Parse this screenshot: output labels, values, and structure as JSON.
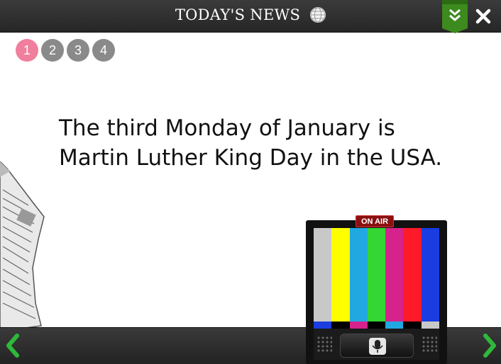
{
  "header": {
    "title": "TODAY'S NEWS",
    "globe_icon": "globe-icon",
    "bookmark_icon": "double-chevron-down-icon",
    "close_icon": "close-icon",
    "bookmark_color": "#3d8a1f"
  },
  "pager": {
    "pages": [
      "1",
      "2",
      "3",
      "4"
    ],
    "active_page": "1",
    "active_color": "#ef7f9c",
    "inactive_color": "#8a8a8a"
  },
  "content": {
    "headline": "The third Monday of January is Martin Luther King Day in the USA."
  },
  "tv": {
    "badge": "ON AIR",
    "bars": [
      "#c8c8c8",
      "#ffff00",
      "#22a8e0",
      "#33d633",
      "#d6228c",
      "#ff1a2a",
      "#1a3ce0"
    ],
    "bar_feet": [
      "#1a3ce0",
      "#000000",
      "#d6228c",
      "#000000",
      "#22a8e0",
      "#000000",
      "#c8c8c8"
    ],
    "mic_icon": "microphone-icon"
  },
  "navigation": {
    "prev_icon": "chevron-left-icon",
    "next_icon": "chevron-right-icon",
    "arrow_color": "#2fb83a"
  }
}
